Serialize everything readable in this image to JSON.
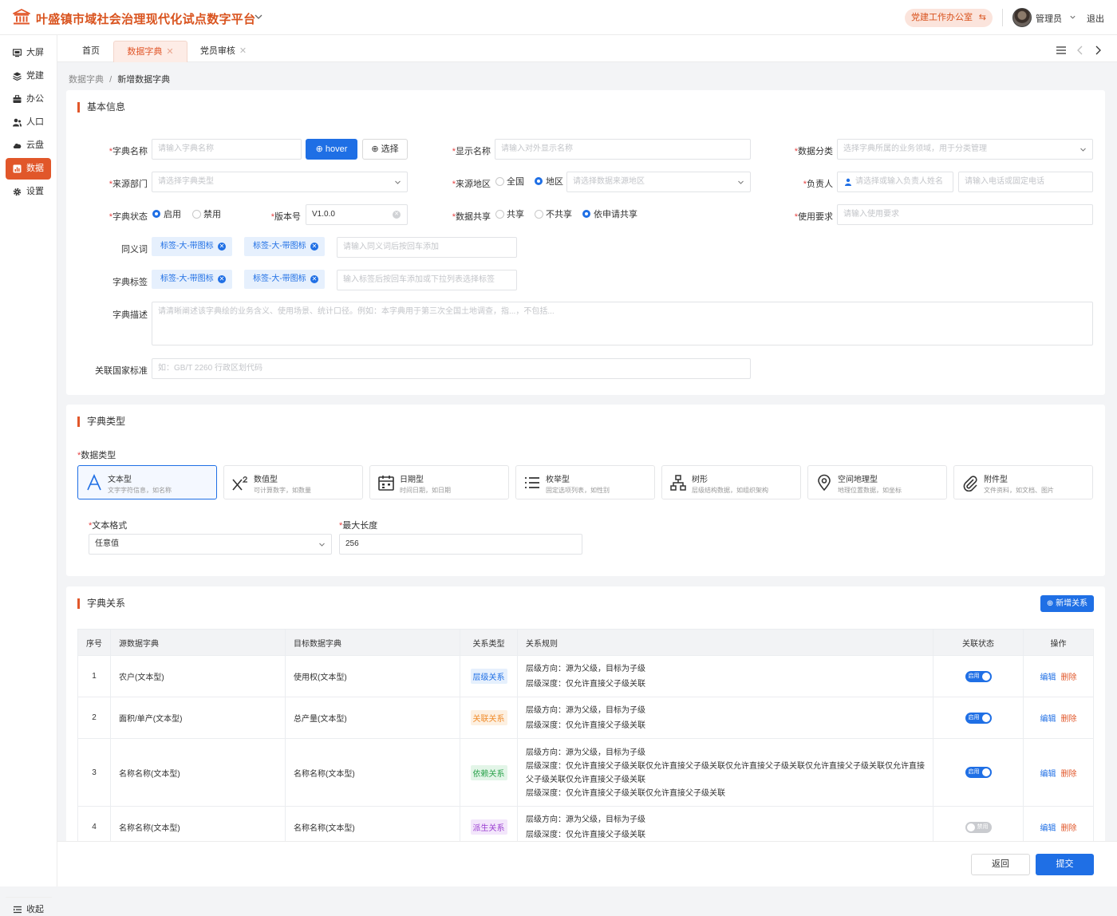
{
  "header": {
    "title": "叶盛镇市域社会治理现代化试点数字平台",
    "office": "党建工作办公室",
    "user": "管理员",
    "logout": "退出"
  },
  "sidebar": {
    "items": [
      {
        "label": "大屏",
        "icon": "screen-icon"
      },
      {
        "label": "党建",
        "icon": "layers-icon"
      },
      {
        "label": "办公",
        "icon": "briefcase-icon"
      },
      {
        "label": "人口",
        "icon": "people-icon"
      },
      {
        "label": "云盘",
        "icon": "cloud-icon"
      },
      {
        "label": "数据",
        "icon": "data-icon",
        "active": true
      },
      {
        "label": "设置",
        "icon": "gear-icon"
      }
    ],
    "collapse": "收起"
  },
  "tabs": [
    {
      "label": "首页"
    },
    {
      "label": "数据字典",
      "active": true
    },
    {
      "label": "党员审核"
    }
  ],
  "breadcrumb": {
    "parent": "数据字典",
    "sep": "/",
    "current": "新增数据字典"
  },
  "basic": {
    "title": "基本信息",
    "dict_name": {
      "label": "字典名称",
      "placeholder": "请输入字典名称"
    },
    "hover_btn": "hover",
    "select_btn": "选择",
    "display_name": {
      "label": "显示名称",
      "placeholder": "请输入对外显示名称"
    },
    "category": {
      "label": "数据分类",
      "placeholder": "选择字典所属的业务领域，用于分类管理"
    },
    "source_dept": {
      "label": "来源部门",
      "placeholder": "请选择字典类型"
    },
    "source_area": {
      "label": "来源地区",
      "opt_all": "全国",
      "opt_region": "地区",
      "placeholder": "请选择数据来源地区"
    },
    "owner": {
      "label": "负责人",
      "placeholder": "请选择或输入负责人姓名",
      "phone_placeholder": "请输入电话或固定电话"
    },
    "status": {
      "label": "字典状态",
      "opt_on": "启用",
      "opt_off": "禁用"
    },
    "version": {
      "label": "版本号",
      "value": "V1.0.0"
    },
    "share": {
      "label": "数据共享",
      "opt1": "共享",
      "opt2": "不共享",
      "opt3": "依申请共享"
    },
    "usage": {
      "label": "使用要求",
      "placeholder": "请输入使用要求"
    },
    "synonyms": {
      "label": "同义词",
      "tags": [
        "标签-大-带图标",
        "标签-大-带图标"
      ],
      "placeholder": "请输入同义词后按回车添加"
    },
    "dict_tags": {
      "label": "字典标签",
      "tags": [
        "标签-大-带图标",
        "标签-大-带图标"
      ],
      "placeholder": "输入标签后按回车添加或下拉列表选择标签"
    },
    "description": {
      "label": "字典描述",
      "placeholder": "请清晰阐述该字典绘的业务含义、使用场景、统计口径。例如：本字典用于第三次全国土地调查，指...，不包括..."
    },
    "standard": {
      "label": "关联国家标准",
      "placeholder": "如：GB/T 2260 行政区划代码"
    }
  },
  "dict_type": {
    "title": "字典类型",
    "data_type_label": "数据类型",
    "cards": [
      {
        "title": "文本型",
        "desc": "文字字符信息，如名称",
        "icon": "text-a-icon",
        "selected": true
      },
      {
        "title": "数值型",
        "desc": "可计算数字，如数量",
        "icon": "superscript-icon"
      },
      {
        "title": "日期型",
        "desc": "时间日期，如日期",
        "icon": "calendar-icon"
      },
      {
        "title": "枚举型",
        "desc": "固定选项列表，如性别",
        "icon": "list-icon"
      },
      {
        "title": "树形",
        "desc": "层级结构数据，如组织架构",
        "icon": "tree-icon"
      },
      {
        "title": "空间地理型",
        "desc": "地理位置数据，如坐标",
        "icon": "location-icon"
      },
      {
        "title": "附件型",
        "desc": "文件资料，如文档、图片",
        "icon": "paperclip-icon"
      }
    ],
    "text_format": {
      "label": "文本格式",
      "value": "任意值"
    },
    "max_length": {
      "label": "最大长度",
      "value": "256"
    }
  },
  "relations": {
    "title": "字典关系",
    "add_btn": "新增关系",
    "columns": [
      "序号",
      "源数据字典",
      "目标数据字典",
      "关系类型",
      "关系规则",
      "关联状态",
      "操作"
    ],
    "rows": [
      {
        "no": "1",
        "source": "农户(文本型)",
        "target": "使用权(文本型)",
        "type": "层级关系",
        "type_color": "#1f6fe5",
        "type_bg": "#e6f0fd",
        "rules": [
          "层级方向：源为父级，目标为子级",
          "层级深度：仅允许直接父子级关联"
        ],
        "status": "启用",
        "on": true
      },
      {
        "no": "2",
        "source": "面积/单产(文本型)",
        "target": "总产量(文本型)",
        "type": "关联关系",
        "type_color": "#f08c2b",
        "type_bg": "#fdf0e1",
        "rules": [
          "层级方向：源为父级，目标为子级",
          "层级深度：仅允许直接父子级关联"
        ],
        "status": "启用",
        "on": true
      },
      {
        "no": "3",
        "source": "名称名称(文本型)",
        "target": "名称名称(文本型)",
        "type": "依赖关系",
        "type_color": "#2ea44f",
        "type_bg": "#e3f5e8",
        "rules": [
          "层级方向：源为父级，目标为子级",
          "层级深度：仅允许直接父子级关联仅允许直接父子级关联仅允许直接父子级关联仅允许直接父子级关联仅允许直接父子级关联仅允许直接父子级关联",
          "层级深度：仅允许直接父子级关联仅允许直接父子级关联"
        ],
        "status": "启用",
        "on": true
      },
      {
        "no": "4",
        "source": "名称名称(文本型)",
        "target": "名称名称(文本型)",
        "type": "派生关系",
        "type_color": "#9b3fd1",
        "type_bg": "#f3e6fb",
        "rules": [
          "层级方向：源为父级，目标为子级",
          "层级深度：仅允许直接父子级关联"
        ],
        "status": "禁用",
        "on": false
      }
    ],
    "edit": "编辑",
    "delete": "删除"
  },
  "footer": {
    "back": "返回",
    "submit": "提交"
  },
  "colors": {
    "brand": "#e1572a",
    "primary": "#1f6fe5"
  }
}
